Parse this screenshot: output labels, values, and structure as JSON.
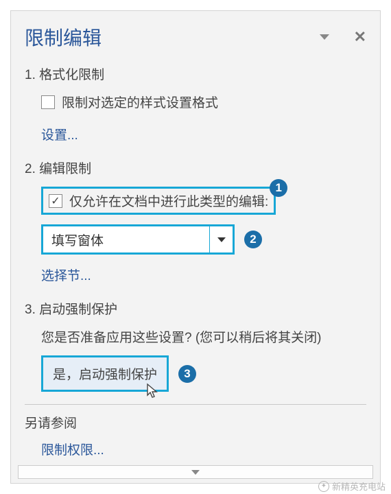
{
  "panel": {
    "title": "限制编辑"
  },
  "section1": {
    "heading": "1. 格式化限制",
    "checkbox_label": "限制对选定的样式设置格式",
    "checked": false,
    "settings_link": "设置..."
  },
  "section2": {
    "heading": "2. 编辑限制",
    "checkbox_label": "仅允许在文档中进行此类型的编辑:",
    "checked": true,
    "dropdown_value": "填写窗体",
    "select_sections_link": "选择节..."
  },
  "section3": {
    "heading": "3. 启动强制保护",
    "prompt": "您是否准备应用这些设置? (您可以稍后将其关闭)",
    "button_label": "是，启动强制保护"
  },
  "see_also": {
    "heading": "另请参阅",
    "restrict_link": "限制权限..."
  },
  "badges": {
    "b1": "1",
    "b2": "2",
    "b3": "3"
  },
  "watermark": "新精英充电站"
}
